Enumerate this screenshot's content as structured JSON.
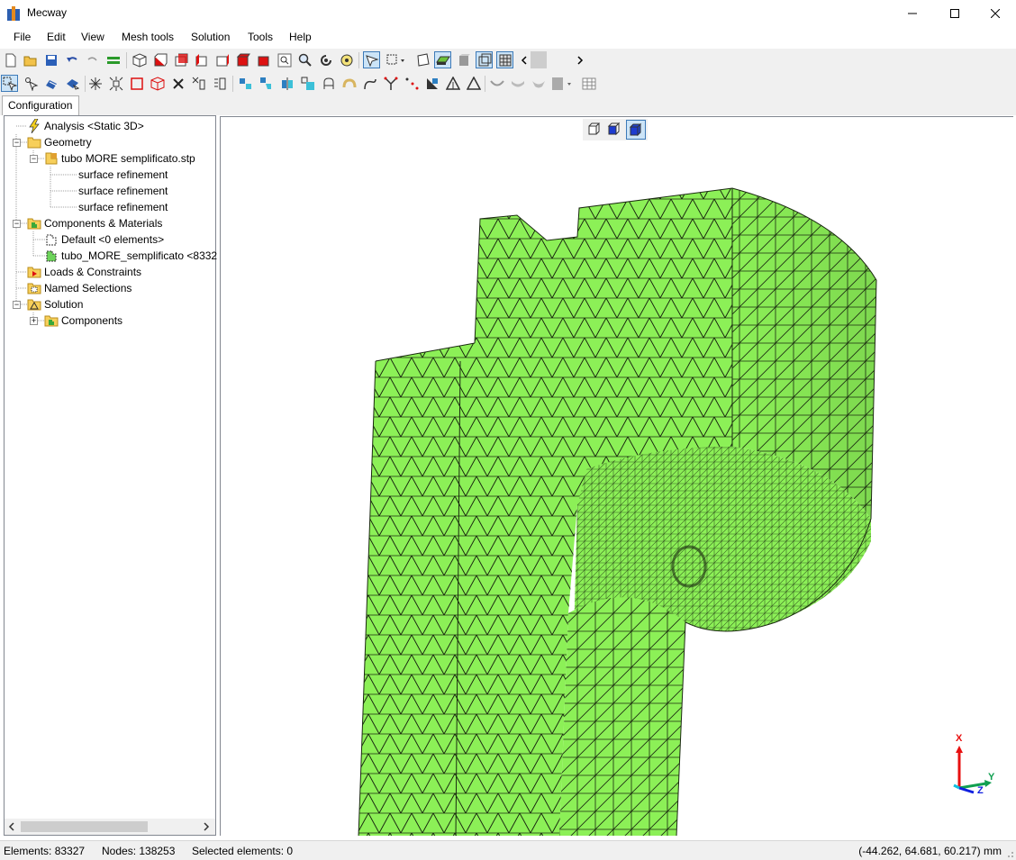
{
  "window": {
    "title": "Mecway",
    "minimize_glyph": "—",
    "maximize_glyph": "☐",
    "close_glyph": "✕"
  },
  "menu": [
    "File",
    "Edit",
    "View",
    "Mesh tools",
    "Solution",
    "Tools",
    "Help"
  ],
  "toolbar": {
    "row1_icons": [
      "new-icon",
      "open-icon",
      "save-icon",
      "undo-icon",
      "redo-icon",
      "merge-icon",
      "view-iso-icon",
      "view-front-icon",
      "view-back-icon",
      "view-left-icon",
      "view-right-icon",
      "view-top-icon",
      "view-bottom-icon",
      "zoom-window-icon",
      "zoom-icon",
      "rotate-icon",
      "pan-icon",
      "select-mode-icon",
      "selection-dropdown-icon",
      "wireframe-icon",
      "surface-icon",
      "solid-icon",
      "outline-icon",
      "mesh-icon"
    ],
    "row2_icons": [
      "pointer-icon",
      "select-node-icon",
      "select-face-icon",
      "select-element-icon",
      "star-node-icon",
      "explode-icon",
      "square-icon",
      "cube-wire-icon",
      "delete-icon",
      "split-icon",
      "extrude-icon",
      "refine-icon",
      "mirror-icon",
      "copy-icon",
      "move-icon",
      "revolve-icon",
      "bend-icon",
      "sweep-icon",
      "branch-icon",
      "scatter-icon",
      "triangle-fill-icon",
      "triangle-hatch-icon",
      "triangle-outline-icon",
      "shell-icon",
      "surface-edit-icon",
      "beam-icon",
      "table-icon"
    ]
  },
  "tabs": [
    "Configuration"
  ],
  "tree": [
    {
      "label": "Analysis <Static 3D>",
      "icon": "lightning-icon",
      "level": 1
    },
    {
      "label": "Geometry",
      "icon": "folder-icon",
      "level": 1,
      "expander": "−"
    },
    {
      "label": "tubo MORE semplificato.stp",
      "icon": "geometry-file-icon",
      "level": 2,
      "expander": "−"
    },
    {
      "label": "surface refinement",
      "icon": "",
      "level": 3
    },
    {
      "label": "surface refinement",
      "icon": "",
      "level": 3
    },
    {
      "label": "surface refinement",
      "icon": "",
      "level": 3
    },
    {
      "label": "Components & Materials",
      "icon": "components-icon",
      "level": 1,
      "expander": "−"
    },
    {
      "label": "Default <0 elements>",
      "icon": "component-icon",
      "level": 2
    },
    {
      "label": "tubo_MORE_semplificato <8332",
      "icon": "component-green-icon",
      "level": 2
    },
    {
      "label": "Loads & Constraints",
      "icon": "loads-icon",
      "level": 1
    },
    {
      "label": "Named Selections",
      "icon": "named-selection-icon",
      "level": 1
    },
    {
      "label": "Solution",
      "icon": "solution-icon",
      "level": 1,
      "expander": "−"
    },
    {
      "label": "Components",
      "icon": "components-icon",
      "level": 2,
      "expander": "+"
    }
  ],
  "viewport": {
    "view_buttons": [
      "view-wire-icon",
      "view-shaded-icon",
      "view-solid-icon"
    ],
    "mesh_color": "#8cf057",
    "axes": {
      "x": "X",
      "y": "Y",
      "z": "Z"
    }
  },
  "status": {
    "elements": "Elements: 83327",
    "nodes": "Nodes: 138253",
    "selected": "Selected elements: 0",
    "coords": "(-44.262, 64.681, 60.217) mm"
  }
}
